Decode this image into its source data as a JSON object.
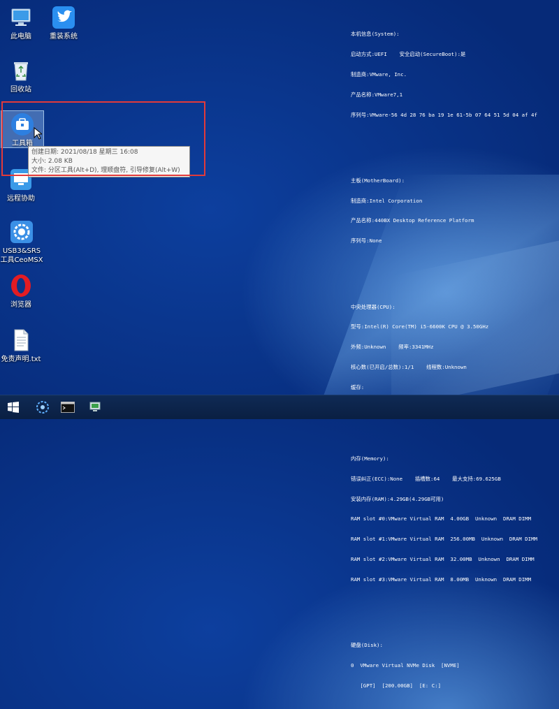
{
  "desktop_icons": [
    {
      "label": "此电脑",
      "icon": "computer-icon"
    },
    {
      "label": "重装系统",
      "icon": "bird-app-icon"
    },
    {
      "label": "回收站",
      "icon": "recycle-bin-icon"
    },
    {
      "label": "工具箱",
      "icon": "toolbox-icon"
    },
    {
      "label": "远程协助",
      "icon": "remote-assist-icon"
    },
    {
      "label": "USB3&SRS\n工具CeoMSX",
      "icon": "gear-app-icon"
    },
    {
      "label": "浏览器",
      "icon": "opera-icon"
    },
    {
      "label": "免责声明.txt",
      "icon": "text-file-icon"
    }
  ],
  "tooltip": {
    "created": "创建日期: 2021/08/18 星期三 16:08",
    "size": "大小: 2.08 KB",
    "desc": "文件: 分区工具(Alt+D), 理顺盘符, 引导修复(Alt+W)"
  },
  "sysinfo": {
    "system": [
      "本机信息(System):",
      "启动方式:UEFI    安全启动(SecureBoot):是",
      "制造商:VMware, Inc.",
      "产品名称:VMware7,1",
      "序列号:VMware-56 4d 28 76 ba 19 1e 61-5b 07 64 51 5d 04 af 4f"
    ],
    "motherboard": [
      "主板(MotherBoard):",
      "制造商:Intel Corporation",
      "产品名称:440BX Desktop Reference Platform",
      "序列号:None"
    ],
    "cpu": [
      "中央处理器(CPU):",
      "型号:Intel(R) Core(TM) i5-6600K CPU @ 3.50GHz",
      "外频:Unknown    频率:3341MHz",
      "核心数(已开启/总数):1/1    线程数:Unknown",
      "缓存:"
    ],
    "memory": [
      "内存(Memory):",
      "错误纠正(ECC):None    插槽数:64    最大支持:69.625GB",
      "安装内存(RAM):4.29GB(4.29GB可用)",
      "RAM slot #0:VMware Virtual RAM  4.00GB  Unknown  DRAM DIMM",
      "RAM slot #1:VMware Virtual RAM  256.00MB  Unknown  DRAM DIMM",
      "RAM slot #2:VMware Virtual RAM  32.00MB  Unknown  DRAM DIMM",
      "RAM slot #3:VMware Virtual RAM  8.00MB  Unknown  DRAM DIMM"
    ],
    "disk": [
      "硬盘(Disk):",
      "0  VMware Virtual NVMe Disk  [NVME]",
      "   [GPT]  [200.00GB]  [E: C:]"
    ]
  },
  "taskbar": {
    "items": [
      "start-icon",
      "tool-tray-icon",
      "command-prompt-icon",
      "network-monitor-icon"
    ]
  }
}
